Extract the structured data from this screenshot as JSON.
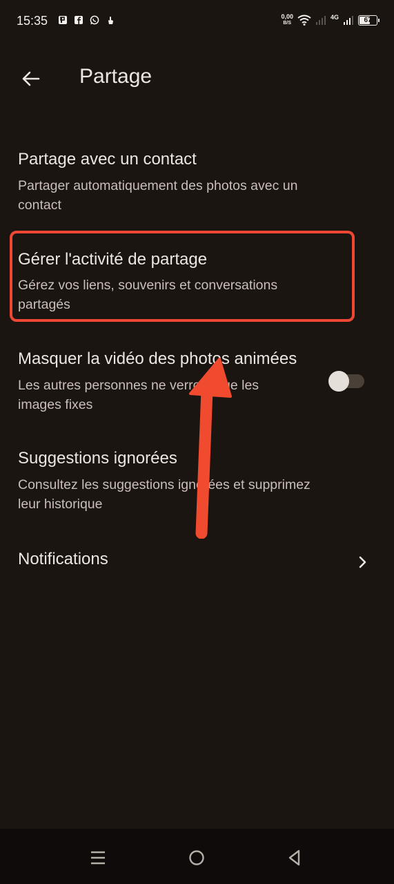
{
  "status_bar": {
    "time": "15:35",
    "net_speed_value": "0,00",
    "net_speed_unit": "B/S",
    "network_type": "4G",
    "battery": "67",
    "battery_level": 0.67,
    "left_icons": [
      "powerpoint-icon",
      "facebook-icon",
      "whatsapp-icon",
      "touch-icon"
    ],
    "right_icons": [
      "wifi-icon",
      "signal-icon",
      "signal-4g-icon",
      "battery-icon"
    ]
  },
  "header": {
    "title": "Partage",
    "back_icon": "arrow-left-icon"
  },
  "items": [
    {
      "title": "Partage avec un contact",
      "subtitle_line1": "Partager automatiquement des photos avec un",
      "subtitle_line2": "contact"
    },
    {
      "title": "Gérer l'activité de partage",
      "subtitle_line1": "Gérez vos liens, souvenirs et conversations",
      "subtitle_line2": "partagés"
    },
    {
      "title": "Masquer la vidéo des photos animées",
      "subtitle_line1": "Les autres personnes ne verront que les",
      "subtitle_line2": "images fixes",
      "toggle_on": false
    },
    {
      "title": "Suggestions ignorées",
      "subtitle_line1": "Consultez les suggestions ignorées et supprimez",
      "subtitle_line2": "leur historique"
    },
    {
      "title": "Notifications",
      "trailing_icon": "chevron-right-icon"
    }
  ],
  "annotation": {
    "highlight_color": "#ee4733",
    "arrow_color": "#f04a2f"
  },
  "nav_bar": {
    "icons": [
      "recents-icon",
      "home-icon",
      "back-triangle-icon"
    ]
  },
  "colors": {
    "background": "#1b1511",
    "text_primary": "#ece6e2",
    "text_secondary": "#c9bfb8"
  }
}
